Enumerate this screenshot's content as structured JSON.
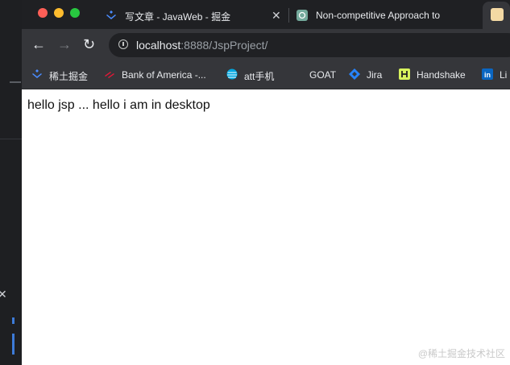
{
  "tabs": [
    {
      "title": "写文章 - JavaWeb - 掘金",
      "favicon": "juejin-icon"
    },
    {
      "title": "Non-competitive Approach to",
      "favicon": "openai-icon"
    }
  ],
  "active_tab": {
    "favicon": "page-icon"
  },
  "address_bar": {
    "host": "localhost",
    "path": ":8888/JspProject/"
  },
  "bookmarks": [
    {
      "label": "稀土掘金",
      "icon": "juejin-icon"
    },
    {
      "label": "Bank of America -...",
      "icon": "bofa-icon"
    },
    {
      "label": "att手机",
      "icon": "att-icon"
    },
    {
      "label": "GOAT",
      "icon": "goat-icon"
    },
    {
      "label": "Jira",
      "icon": "jira-icon"
    },
    {
      "label": "Handshake",
      "icon": "handshake-icon"
    },
    {
      "label": "Li",
      "icon": "linkedin-icon"
    }
  ],
  "page": {
    "body_text": "hello jsp ... hello i am in desktop"
  },
  "watermark": "@稀土掘金技术社区",
  "colors": {
    "close": "#ff5f57",
    "minimize": "#febc2e",
    "maximize": "#28c840",
    "toolbar": "#35363a",
    "tabbar": "#1f2023"
  }
}
